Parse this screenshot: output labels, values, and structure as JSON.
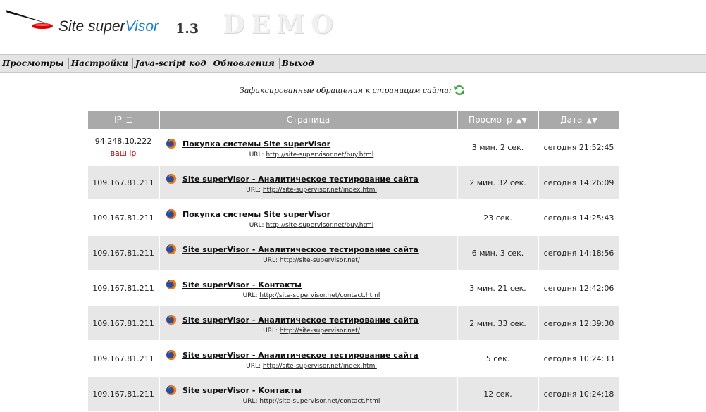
{
  "header": {
    "brand_site": "Site super",
    "brand_visor": "Visor",
    "version": "1.3",
    "demo": "DEMO"
  },
  "menu": [
    {
      "label": "Просмотры"
    },
    {
      "label": "Настройки"
    },
    {
      "label": "Java-script код"
    },
    {
      "label": "Обновления"
    },
    {
      "label": "Выход"
    }
  ],
  "caption": "Зафиксированные обращения к страницам сайта:",
  "table": {
    "headers": {
      "ip": "IP",
      "page": "Страница",
      "view": "Просмотр",
      "date": "Дата"
    },
    "url_prefix": "URL:",
    "your_ip_label": "ваш ip",
    "rows": [
      {
        "ip": "94.248.10.222",
        "title": "Покупка системы Site superVisor",
        "url": "http://site-supervisor.net/buy.html",
        "view": "3 мин. 2 сек.",
        "date": "сегодня 21:52:45"
      },
      {
        "ip": "109.167.81.211",
        "title": "Site superVisor - Аналитическое тестирование сайта",
        "url": "http://site-supervisor.net/index.html",
        "view": "2 мин. 32 сек.",
        "date": "сегодня 14:26:09"
      },
      {
        "ip": "109.167.81.211",
        "title": "Покупка системы Site superVisor",
        "url": "http://site-supervisor.net/buy.html",
        "view": "23 сек.",
        "date": "сегодня 14:25:43"
      },
      {
        "ip": "109.167.81.211",
        "title": "Site superVisor - Аналитическое тестирование сайта",
        "url": "http://site-supervisor.net/",
        "view": "6 мин. 3 сек.",
        "date": "сегодня 14:18:56"
      },
      {
        "ip": "109.167.81.211",
        "title": "Site superVisor - Контакты",
        "url": "http://site-supervisor.net/contact.html",
        "view": "3 мин. 21 сек.",
        "date": "сегодня 12:42:06"
      },
      {
        "ip": "109.167.81.211",
        "title": "Site superVisor - Аналитическое тестирование сайта",
        "url": "http://site-supervisor.net/",
        "view": "2 мин. 33 сек.",
        "date": "сегодня 12:39:30"
      },
      {
        "ip": "109.167.81.211",
        "title": "Site superVisor - Аналитическое тестирование сайта",
        "url": "http://site-supervisor.net/index.html",
        "view": "5 сек.",
        "date": "сегодня 10:24:33"
      },
      {
        "ip": "109.167.81.211",
        "title": "Site superVisor - Контакты",
        "url": "http://site-supervisor.net/contact.html",
        "view": "12 сек.",
        "date": "сегодня 10:24:18"
      }
    ]
  },
  "icons": {
    "browser": "firefox-icon",
    "refresh": "refresh-icon",
    "sort_ip": "filter-menu-icon",
    "sort_view": "sort-arrows-icon",
    "sort_date": "sort-arrow-icon"
  },
  "colors": {
    "header_bg": "#a9a9a9",
    "row_alt": "#e7e7e7",
    "menubar": "#e4e4e4",
    "brand_blue": "#1a7fd6",
    "your_ip": "#c00000"
  }
}
